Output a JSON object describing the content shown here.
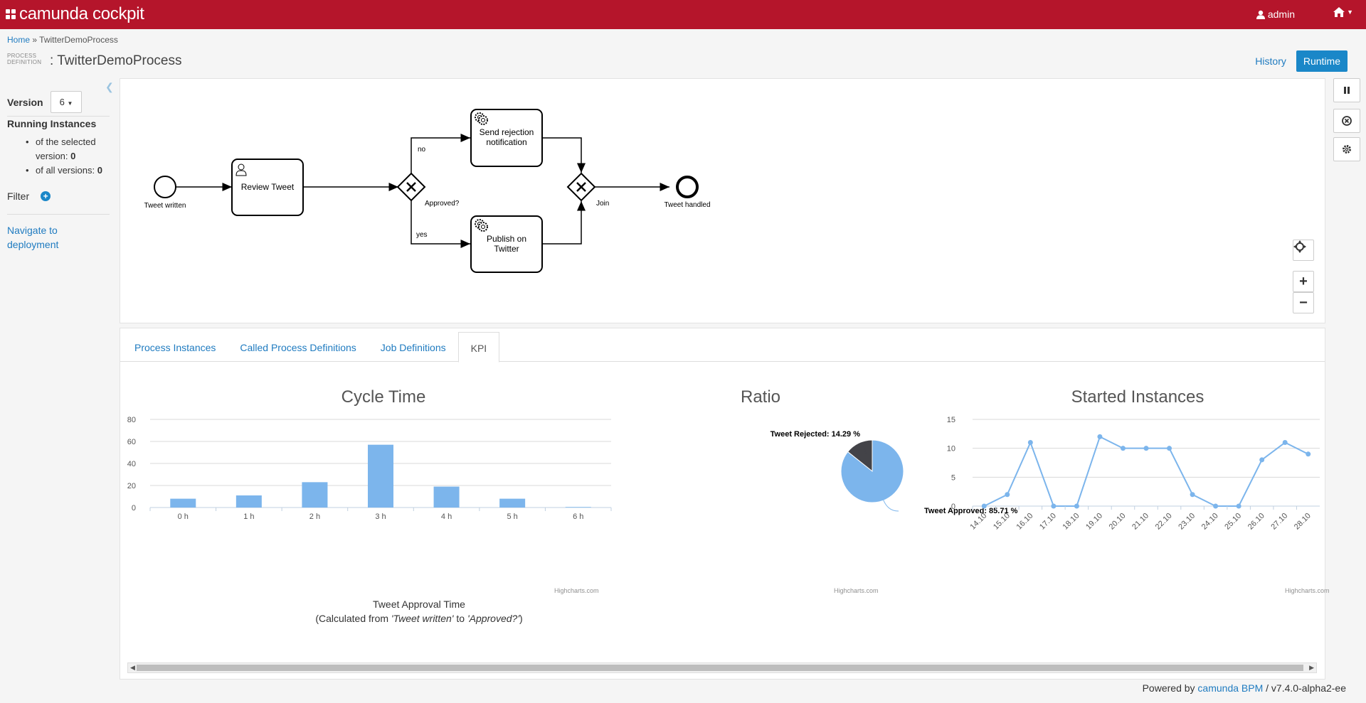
{
  "app": {
    "brand": "camunda cockpit",
    "user": "admin"
  },
  "breadcrumb": {
    "home": "Home",
    "sep": "»",
    "current": "TwitterDemoProcess"
  },
  "title": {
    "label_line1": "PROCESS",
    "label_line2": "DEFINITION",
    "prefix": ":",
    "name": "TwitterDemoProcess"
  },
  "view_switch": {
    "history": "History",
    "runtime": "Runtime"
  },
  "sidebar": {
    "version_label": "Version",
    "version_value": "6",
    "running_title": "Running Instances",
    "selected_text": "of the selected version:",
    "selected_count": "0",
    "all_text": "of all versions:",
    "all_count": "0",
    "filter_label": "Filter",
    "navigate": "Navigate to deployment"
  },
  "diagram": {
    "start_event": "Tweet written",
    "review_task": "Review Tweet",
    "gateway_approved": "Approved?",
    "flow_no": "no",
    "flow_yes": "yes",
    "rejection_line1": "Send rejection",
    "rejection_line2": "notification",
    "publish_line1": "Publish on",
    "publish_line2": "Twitter",
    "join": "Join",
    "end_event": "Tweet handled"
  },
  "tabs": [
    {
      "label": "Process Instances",
      "active": false
    },
    {
      "label": "Called Process Definitions",
      "active": false
    },
    {
      "label": "Job Definitions",
      "active": false
    },
    {
      "label": "KPI",
      "active": true
    }
  ],
  "highcharts_credit": "Highcharts.com",
  "chart_data": [
    {
      "type": "bar",
      "title": "Cycle Time",
      "categories": [
        "0 h",
        "1 h",
        "2 h",
        "3 h",
        "4 h",
        "5 h",
        "6 h"
      ],
      "values": [
        8,
        11,
        23,
        57,
        19,
        8,
        0.5
      ],
      "ylim": [
        0,
        80
      ],
      "yticks": [
        0,
        20,
        40,
        60,
        80
      ],
      "xlabel_line1": "Tweet Approval Time",
      "xlabel_line2_prefix": "(Calculated from ",
      "xlabel_line2_from": "'Tweet written'",
      "xlabel_line2_mid": " to ",
      "xlabel_line2_to": "'Approved?'",
      "xlabel_line2_suffix": ")",
      "grid": true,
      "color": "#7cb5ec"
    },
    {
      "type": "pie",
      "title": "Ratio",
      "slices": [
        {
          "label": "Tweet Rejected",
          "value": 14.29,
          "text": "Tweet Rejected: 14.29 %",
          "color": "#434348"
        },
        {
          "label": "Tweet Approved",
          "value": 85.71,
          "text": "Tweet Approved: 85.71 %",
          "color": "#7cb5ec"
        }
      ]
    },
    {
      "type": "line",
      "title": "Started Instances",
      "x": [
        "14.10",
        "15.10",
        "16.10",
        "17.10",
        "18.10",
        "19.10",
        "20.10",
        "21.10",
        "22.10",
        "23.10",
        "24.10",
        "25.10",
        "26.10",
        "27.10",
        "28.10"
      ],
      "values": [
        0,
        2,
        11,
        0,
        0,
        12,
        10,
        10,
        10,
        2,
        0,
        0,
        8,
        11,
        9
      ],
      "ylim": [
        0,
        15
      ],
      "yticks": [
        0,
        5,
        10,
        15
      ],
      "grid": true,
      "color": "#7cb5ec"
    }
  ],
  "footer": {
    "powered": "Powered by ",
    "product": "camunda BPM",
    "version": " / v7.4.0-alpha2-ee"
  }
}
